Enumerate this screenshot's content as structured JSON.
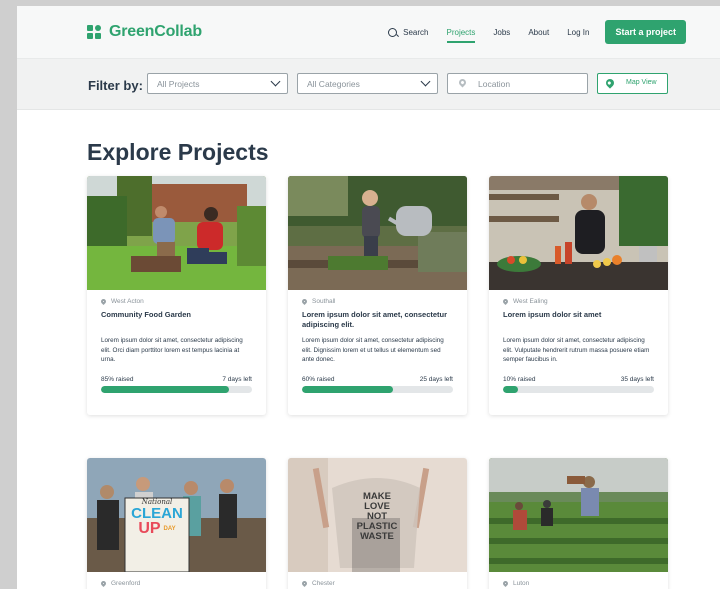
{
  "brand": {
    "name": "GreenCollab",
    "icon": "grid-logo-icon",
    "accent": "#2fa36f"
  },
  "nav": {
    "search": "Search",
    "items": [
      "Projects",
      "Jobs",
      "About",
      "Log In"
    ],
    "active": "Projects",
    "cta": "Start a project"
  },
  "filters": {
    "label": "Filter by:",
    "projects": "All Projects",
    "categories": "All Categories",
    "location_placeholder": "Location",
    "map_view": "Map View"
  },
  "page_title": "Explore Projects",
  "cards": [
    {
      "location": "West Acton",
      "title": "Community Food Garden",
      "description": "Lorem ipsum dolor sit amet, consectetur adipiscing elit. Orci diam porttitor lorem est tempus lacinia at urna.",
      "raised": "85% raised",
      "progress": 0.85,
      "days": "7 days left",
      "image": "gardening-photo"
    },
    {
      "location": "Southall",
      "title": "Lorem ipsum dolor sit amet, consectetur adipiscing elit.",
      "description": "Lorem ipsum dolor sit amet, consectetur adipiscing elit. Dignissim lorem et ut tellus ut elementum sed ante donec.",
      "raised": "60% raised",
      "progress": 0.6,
      "days": "25 days left",
      "image": "child-watering-photo"
    },
    {
      "location": "West Ealing",
      "title": "Lorem ipsum dolor sit amet",
      "description": "Lorem ipsum dolor sit amet, consectetur adipiscing elit. Vulputate hendrerit rutrum massa posuere etiam semper faucibus in.",
      "raised": "10% raised",
      "progress": 0.1,
      "days": "35 days left",
      "image": "kitchen-photo"
    },
    {
      "location": "Greenford",
      "image": "cleanup-group-photo",
      "sign": {
        "line1": "National",
        "line2": "CLEAN",
        "line3": "UP",
        "line4": "DAY"
      }
    },
    {
      "location": "Chester",
      "image": "plastic-bag-photo",
      "sign": {
        "line1": "MAKE",
        "line2": "LOVE",
        "line3": "NOT",
        "line4": "PLASTIC",
        "line5": "WASTE"
      }
    },
    {
      "location": "Luton",
      "image": "farm-field-photo"
    }
  ]
}
